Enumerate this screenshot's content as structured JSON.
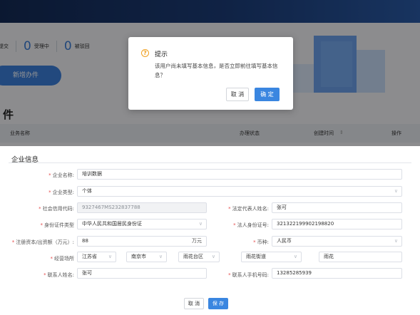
{
  "background": {
    "stats": [
      {
        "label": "提交"
      },
      {
        "count": "0",
        "label": "受理中"
      },
      {
        "count": "0",
        "label": "被驳回"
      }
    ],
    "new_button": "新增办件",
    "list_title": "件",
    "table_headers": [
      "业务名称",
      "办理状态",
      "创建时间",
      "操作"
    ]
  },
  "dialog": {
    "title": "提示",
    "message": "该用户尚未填写基本信息，是否立即前往填写基本信息？",
    "cancel": "取 消",
    "confirm": "确 定"
  },
  "form": {
    "section_title": "企业信息",
    "company_name": {
      "label": "企业名称:",
      "value": "培训数据"
    },
    "company_type": {
      "label": "企业类型:",
      "value": "个体"
    },
    "credit_code": {
      "label": "社会信用代码:",
      "value": "9327467MS232837788"
    },
    "legal_rep": {
      "label": "法定代表人姓名:",
      "value": "张可"
    },
    "id_type": {
      "label": "身份证件类型",
      "value": "中华人民共和国居民身份证"
    },
    "legal_id": {
      "label": "法人身份证号:",
      "value": "321322199902198820"
    },
    "capital": {
      "label": "注册资本/出资额（万元）:",
      "value": "88",
      "unit": "万元"
    },
    "currency": {
      "label": "币种:",
      "value": "人民币"
    },
    "address": {
      "label": "经营场所",
      "province": "江苏省",
      "city": "南京市",
      "district": "雨花台区",
      "street": "雨花街道",
      "detail": "雨花"
    },
    "contact_name": {
      "label": "联系人姓名:",
      "value": "张可"
    },
    "contact_phone": {
      "label": "联系人手机号码:",
      "value": "13285285939"
    },
    "cancel": "取 消",
    "save": "保 存"
  },
  "colors": {
    "primary": "#3a86e0",
    "required": "#e54b4b",
    "warning": "#f0a020",
    "header": "#1c3d78"
  },
  "icons": [
    "warning-icon",
    "dropdown-caret-icon",
    "sort-icon"
  ]
}
